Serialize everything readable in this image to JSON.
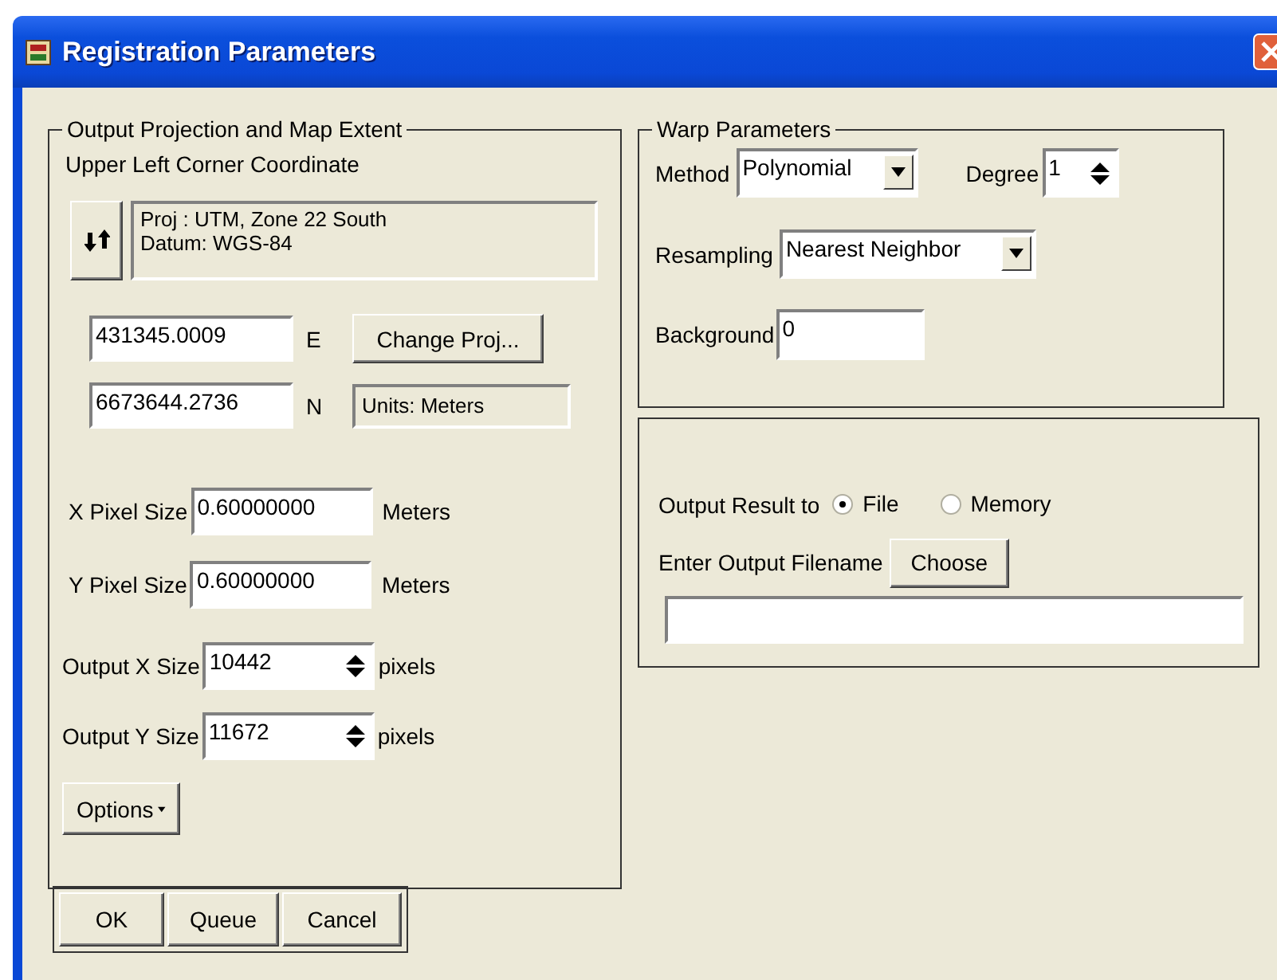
{
  "window": {
    "title": "Registration Parameters"
  },
  "output_projection": {
    "title": "Output Projection and Map Extent",
    "subtitle": "Upper Left Corner Coordinate",
    "projection_lines": [
      "Proj : UTM, Zone 22 South",
      "Datum: WGS-84"
    ],
    "easting": {
      "value": "431345.0009",
      "unit": "E"
    },
    "northing": {
      "value": "6673644.2736",
      "unit": "N"
    },
    "change_button": "Change Proj...",
    "units": "Units: Meters",
    "fields": [
      {
        "label": "X Pixel Size",
        "value": "0.60000000",
        "unit": "Meters",
        "kind": "text"
      },
      {
        "label": "Y Pixel Size",
        "value": "0.60000000",
        "unit": "Meters",
        "kind": "text"
      },
      {
        "label": "Output X Size",
        "value": "10442",
        "unit": "pixels",
        "kind": "spin"
      },
      {
        "label": "Output Y Size",
        "value": "11672",
        "unit": "pixels",
        "kind": "spin"
      }
    ],
    "options_button": "Options"
  },
  "warp": {
    "title": "Warp Parameters",
    "method": {
      "label": "Method",
      "value": "Polynomial"
    },
    "degree": {
      "label": "Degree",
      "value": "1"
    },
    "resampling": {
      "label": "Resampling",
      "value": "Nearest Neighbor"
    },
    "background": {
      "label": "Background",
      "value": "0"
    }
  },
  "output": {
    "label": "Output Result to",
    "options": [
      {
        "label": "File",
        "selected": true
      },
      {
        "label": "Memory",
        "selected": false
      }
    ],
    "filename_label": "Enter Output Filename",
    "choose_button": "Choose"
  },
  "buttons": [
    "OK",
    "Queue",
    "Cancel"
  ]
}
